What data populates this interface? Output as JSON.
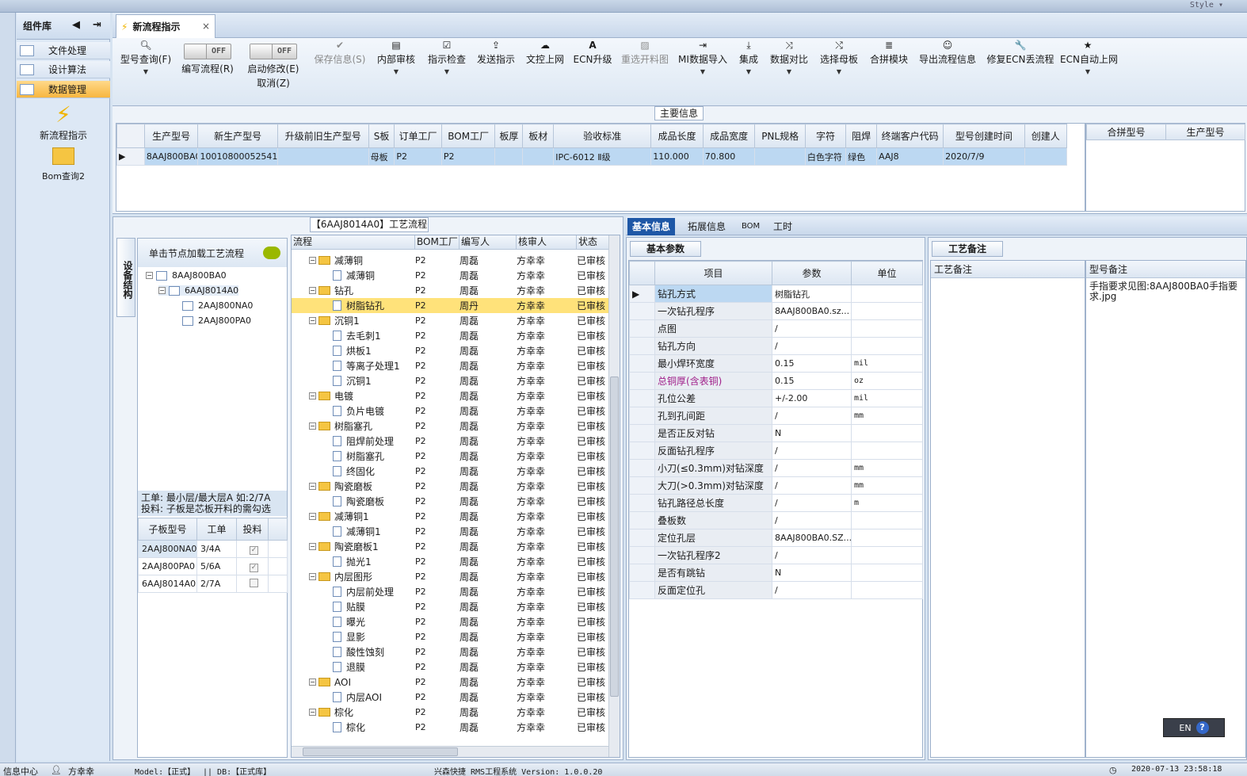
{
  "window": {
    "style_label": "Style ▾"
  },
  "component_library": {
    "title": "组件库",
    "items": [
      {
        "label": "文件处理"
      },
      {
        "label": "设计算法"
      },
      {
        "label": "数据管理"
      }
    ],
    "big_items": [
      {
        "label": "新流程指示"
      },
      {
        "label": "Bom查询2"
      }
    ]
  },
  "tab": {
    "label": "新流程指示",
    "close": "×"
  },
  "toolbar": {
    "model_query": "型号查询(F)",
    "write_flow": "编写流程(R)",
    "start_modify": "启动修改(E)",
    "cancel": "取消(Z)",
    "toggle_off": "OFF",
    "buttons": [
      {
        "label": "保存信息(S)",
        "icon": "✔"
      },
      {
        "label": "内部审核",
        "icon": "▤"
      },
      {
        "label": "指示检查",
        "icon": "☑"
      },
      {
        "label": "发送指示",
        "icon": "⇪"
      },
      {
        "label": "文控上网",
        "icon": "☁"
      },
      {
        "label": "ECN升级",
        "icon": "A"
      },
      {
        "label": "重选开料图",
        "icon": "▨"
      },
      {
        "label": "MI数据导入",
        "icon": "⇥"
      },
      {
        "label": "集成",
        "icon": "⤓"
      },
      {
        "label": "数据对比",
        "icon": "⤨"
      },
      {
        "label": "选择母板",
        "icon": "⤭"
      },
      {
        "label": "合拼模块",
        "icon": "≣"
      },
      {
        "label": "导出流程信息",
        "icon": "☺"
      },
      {
        "label": "修复ECN丢流程",
        "icon": "🔧"
      },
      {
        "label": "ECN自动上网",
        "icon": "★"
      }
    ]
  },
  "main_info": {
    "title": "主要信息",
    "columns": [
      "生产型号",
      "新生产型号",
      "升级前旧生产型号",
      "S板",
      "订单工厂",
      "BOM工厂",
      "板厚",
      "板材",
      "验收标准",
      "成品长度",
      "成品宽度",
      "PNL规格",
      "字符",
      "阻焊",
      "终端客户代码",
      "型号创建时间",
      "创建人"
    ],
    "rows": [
      [
        "8AAJ800BA0",
        "10010800052541",
        "",
        "母板",
        "P2",
        "P2",
        "",
        "",
        "IPC-6012 Ⅱ级",
        "110.000",
        "70.800",
        "",
        "白色字符",
        "绿色",
        "AAJ8",
        "2020/7/9",
        ""
      ]
    ],
    "side_columns": [
      "合拼型号",
      "生产型号"
    ]
  },
  "flow_section": {
    "title": "【6AAJ8014A0】工艺流程",
    "vertical_tab": "设备结构",
    "left_header": "单击节点加载工艺流程",
    "tree": [
      "8AAJ800BA0",
      "6AAJ8014A0",
      "2AAJ800NA0",
      "2AAJ800PA0"
    ],
    "note_line1": "工单: 最小层/最大层A 如:2/7A",
    "note_line2": "投料: 子板是芯板开料的需勾选",
    "sub_columns": [
      "子板型号",
      "工单",
      "投料"
    ],
    "sub_rows": [
      {
        "model": "2AAJ800NA0",
        "order": "3/4A",
        "feed": "✓"
      },
      {
        "model": "2AAJ800PA0",
        "order": "5/6A",
        "feed": "✓"
      },
      {
        "model": "6AAJ8014A0",
        "order": "2/7A",
        "feed": ""
      }
    ],
    "grid_columns": [
      "流程",
      "BOM工厂",
      "编写人",
      "核审人",
      "状态"
    ],
    "flow_rows": [
      {
        "name": "减薄铜",
        "lvl": 0,
        "factory": "P2",
        "writer": "周磊",
        "checker": "方幸幸",
        "status": "已审核"
      },
      {
        "name": "减薄铜",
        "lvl": 1,
        "factory": "P2",
        "writer": "周磊",
        "checker": "方幸幸",
        "status": "已审核"
      },
      {
        "name": "钻孔",
        "lvl": 0,
        "factory": "P2",
        "writer": "周磊",
        "checker": "方幸幸",
        "status": "已审核"
      },
      {
        "name": "树脂钻孔",
        "lvl": 1,
        "factory": "P2",
        "writer": "周丹",
        "checker": "方幸幸",
        "status": "已审核",
        "sel": true
      },
      {
        "name": "沉铜1",
        "lvl": 0,
        "factory": "P2",
        "writer": "周磊",
        "checker": "方幸幸",
        "status": "已审核"
      },
      {
        "name": "去毛刺1",
        "lvl": 1,
        "factory": "P2",
        "writer": "周磊",
        "checker": "方幸幸",
        "status": "已审核"
      },
      {
        "name": "烘板1",
        "lvl": 1,
        "factory": "P2",
        "writer": "周磊",
        "checker": "方幸幸",
        "status": "已审核"
      },
      {
        "name": "等离子处理1",
        "lvl": 1,
        "factory": "P2",
        "writer": "周磊",
        "checker": "方幸幸",
        "status": "已审核"
      },
      {
        "name": "沉铜1",
        "lvl": 1,
        "factory": "P2",
        "writer": "周磊",
        "checker": "方幸幸",
        "status": "已审核"
      },
      {
        "name": "电镀",
        "lvl": 0,
        "factory": "P2",
        "writer": "周磊",
        "checker": "方幸幸",
        "status": "已审核"
      },
      {
        "name": "负片电镀",
        "lvl": 1,
        "factory": "P2",
        "writer": "周磊",
        "checker": "方幸幸",
        "status": "已审核"
      },
      {
        "name": "树脂塞孔",
        "lvl": 0,
        "factory": "P2",
        "writer": "周磊",
        "checker": "方幸幸",
        "status": "已审核"
      },
      {
        "name": "阻焊前处理",
        "lvl": 1,
        "factory": "P2",
        "writer": "周磊",
        "checker": "方幸幸",
        "status": "已审核"
      },
      {
        "name": "树脂塞孔",
        "lvl": 1,
        "factory": "P2",
        "writer": "周磊",
        "checker": "方幸幸",
        "status": "已审核"
      },
      {
        "name": "终固化",
        "lvl": 1,
        "factory": "P2",
        "writer": "周磊",
        "checker": "方幸幸",
        "status": "已审核"
      },
      {
        "name": "陶瓷磨板",
        "lvl": 0,
        "factory": "P2",
        "writer": "周磊",
        "checker": "方幸幸",
        "status": "已审核"
      },
      {
        "name": "陶瓷磨板",
        "lvl": 1,
        "factory": "P2",
        "writer": "周磊",
        "checker": "方幸幸",
        "status": "已审核"
      },
      {
        "name": "减薄铜1",
        "lvl": 0,
        "factory": "P2",
        "writer": "周磊",
        "checker": "方幸幸",
        "status": "已审核"
      },
      {
        "name": "减薄铜1",
        "lvl": 1,
        "factory": "P2",
        "writer": "周磊",
        "checker": "方幸幸",
        "status": "已审核"
      },
      {
        "name": "陶瓷磨板1",
        "lvl": 0,
        "factory": "P2",
        "writer": "周磊",
        "checker": "方幸幸",
        "status": "已审核"
      },
      {
        "name": "抛光1",
        "lvl": 1,
        "factory": "P2",
        "writer": "周磊",
        "checker": "方幸幸",
        "status": "已审核"
      },
      {
        "name": "内层图形",
        "lvl": 0,
        "factory": "P2",
        "writer": "周磊",
        "checker": "方幸幸",
        "status": "已审核"
      },
      {
        "name": "内层前处理",
        "lvl": 1,
        "factory": "P2",
        "writer": "周磊",
        "checker": "方幸幸",
        "status": "已审核"
      },
      {
        "name": "贴膜",
        "lvl": 1,
        "factory": "P2",
        "writer": "周磊",
        "checker": "方幸幸",
        "status": "已审核"
      },
      {
        "name": "曝光",
        "lvl": 1,
        "factory": "P2",
        "writer": "周磊",
        "checker": "方幸幸",
        "status": "已审核"
      },
      {
        "name": "显影",
        "lvl": 1,
        "factory": "P2",
        "writer": "周磊",
        "checker": "方幸幸",
        "status": "已审核"
      },
      {
        "name": "酸性蚀刻",
        "lvl": 1,
        "factory": "P2",
        "writer": "周磊",
        "checker": "方幸幸",
        "status": "已审核"
      },
      {
        "name": "退膜",
        "lvl": 1,
        "factory": "P2",
        "writer": "周磊",
        "checker": "方幸幸",
        "status": "已审核"
      },
      {
        "name": "AOI",
        "lvl": 0,
        "factory": "P2",
        "writer": "周磊",
        "checker": "方幸幸",
        "status": "已审核"
      },
      {
        "name": "内层AOI",
        "lvl": 1,
        "factory": "P2",
        "writer": "周磊",
        "checker": "方幸幸",
        "status": "已审核"
      },
      {
        "name": "棕化",
        "lvl": 0,
        "factory": "P2",
        "writer": "周磊",
        "checker": "方幸幸",
        "status": "已审核"
      },
      {
        "name": "棕化",
        "lvl": 1,
        "factory": "P2",
        "writer": "周磊",
        "checker": "方幸幸",
        "status": "已审核"
      }
    ]
  },
  "right_tabs": [
    "基本信息",
    "拓展信息",
    "BOM",
    "工时"
  ],
  "basic_params": {
    "title": "基本参数",
    "columns": [
      "项目",
      "参数",
      "单位"
    ],
    "rows": [
      {
        "item": "钻孔方式",
        "value": "树脂钻孔",
        "unit": ""
      },
      {
        "item": "一次钻孔程序",
        "value": "8AAJ800BA0.sz...",
        "unit": ""
      },
      {
        "item": "点图",
        "value": "/",
        "unit": ""
      },
      {
        "item": "钻孔方向",
        "value": "/",
        "unit": ""
      },
      {
        "item": "最小焊环宽度",
        "value": "0.15",
        "unit": "mil"
      },
      {
        "item": "总铜厚(含表铜)",
        "value": "0.15",
        "unit": "oz",
        "hl": true
      },
      {
        "item": "孔位公差",
        "value": "+/-2.00",
        "unit": "mil"
      },
      {
        "item": "孔到孔间距",
        "value": "/",
        "unit": "mm"
      },
      {
        "item": "是否正反对钻",
        "value": "N",
        "unit": ""
      },
      {
        "item": "反面钻孔程序",
        "value": "/",
        "unit": ""
      },
      {
        "item": "小刀(≤0.3mm)对钻深度",
        "value": "/",
        "unit": "mm"
      },
      {
        "item": "大刀(>0.3mm)对钻深度",
        "value": "/",
        "unit": "mm"
      },
      {
        "item": "钻孔路径总长度",
        "value": "/",
        "unit": "m"
      },
      {
        "item": "叠板数",
        "value": "/",
        "unit": ""
      },
      {
        "item": "定位孔层",
        "value": "8AAJ800BA0.SZ...",
        "unit": ""
      },
      {
        "item": "一次钻孔程序2",
        "value": "/",
        "unit": ""
      },
      {
        "item": "是否有跳钻",
        "value": "N",
        "unit": ""
      },
      {
        "item": "反面定位孔",
        "value": "/",
        "unit": ""
      }
    ]
  },
  "process_notes": {
    "title": "工艺备注",
    "col1": "工艺备注",
    "col2": "型号备注",
    "text": "手指要求见图:8AAJ800BA0手指要求.jpg"
  },
  "lang": {
    "label": "EN",
    "help": "?"
  },
  "status": {
    "info_center": "信息中心",
    "user": "方幸幸",
    "model": "Model:【正式】",
    "db": "|| DB:【正式库】",
    "system": "兴森快捷 RMS工程系统 Version: 1.0.0.20",
    "datetime": "2020-07-13 23:58:18"
  }
}
